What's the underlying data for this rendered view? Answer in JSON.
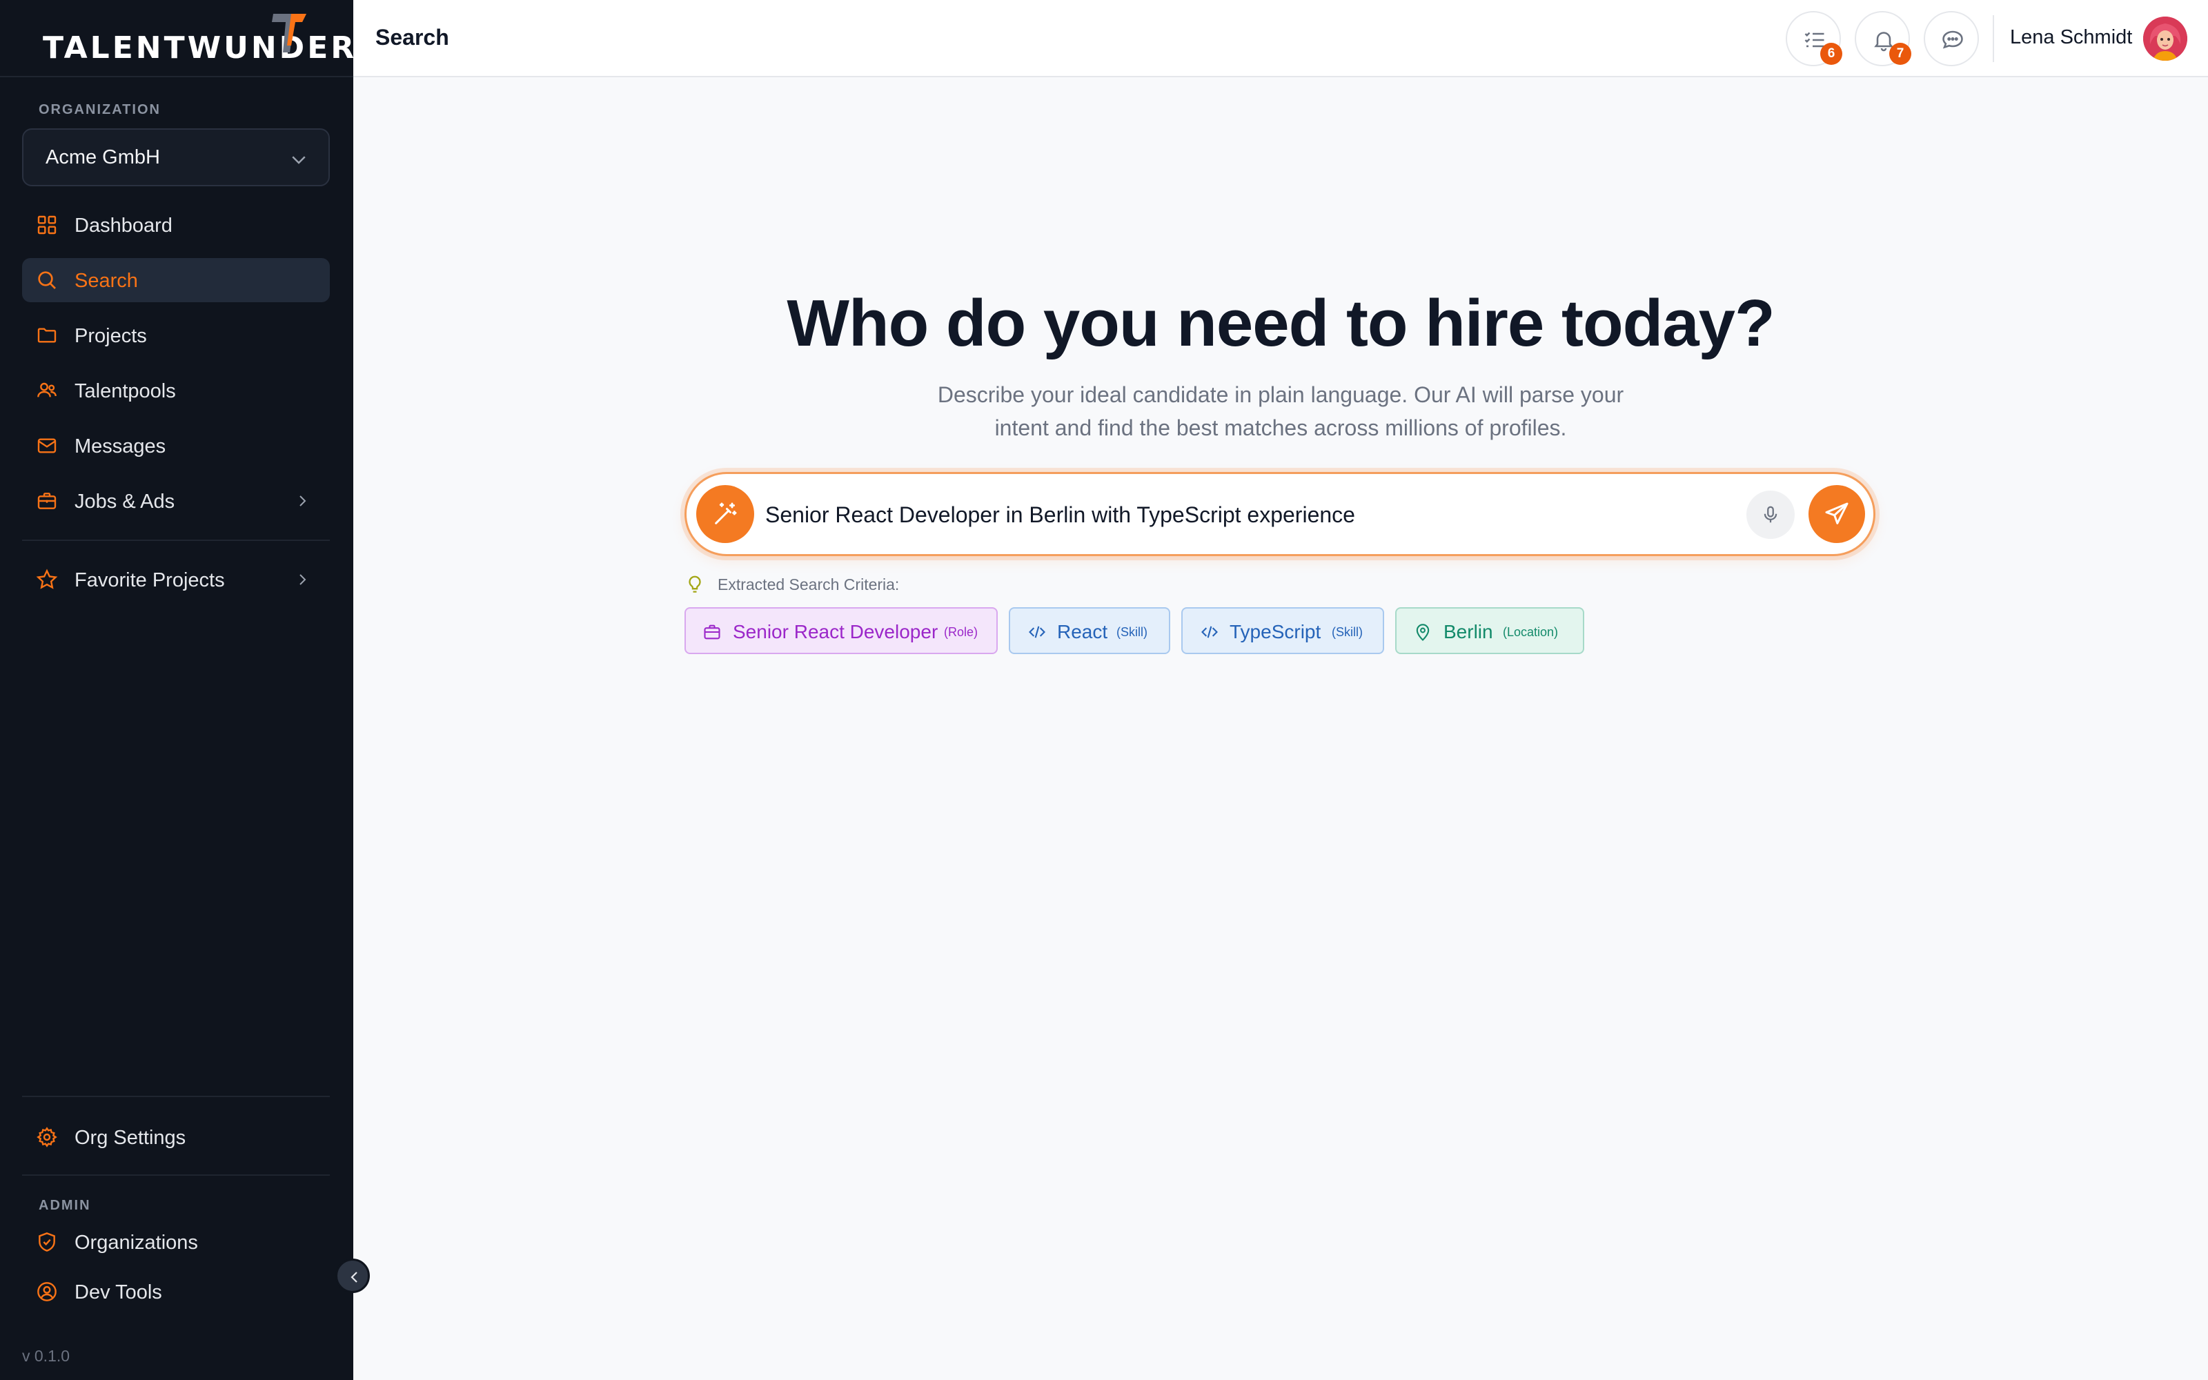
{
  "app": {
    "brand": "TALENTWUNDER",
    "version": "v 0.1.0"
  },
  "sidebar": {
    "org_label": "ORGANIZATION",
    "org_value": "Acme GmbH",
    "items": [
      {
        "label": "Dashboard",
        "icon": "grid-icon"
      },
      {
        "label": "Search",
        "icon": "search-icon",
        "active": true
      },
      {
        "label": "Projects",
        "icon": "folder-icon"
      },
      {
        "label": "Talentpools",
        "icon": "users-icon"
      },
      {
        "label": "Messages",
        "icon": "mail-icon"
      },
      {
        "label": "Jobs & Ads",
        "icon": "briefcase-icon",
        "expandable": true
      }
    ],
    "favorites": {
      "label": "Favorite Projects",
      "icon": "star-icon"
    },
    "settings": {
      "label": "Org Settings",
      "icon": "gear-icon"
    },
    "admin_label": "ADMIN",
    "admin_items": [
      {
        "label": "Organizations",
        "icon": "shield-icon"
      },
      {
        "label": "Dev Tools",
        "icon": "user-circle-icon"
      }
    ]
  },
  "header": {
    "title": "Search",
    "tasks_count": "6",
    "notifications_count": "7",
    "user_name": "Lena Schmidt"
  },
  "main": {
    "headline": "Who do you need to hire today?",
    "subtitle_line1": "Describe your ideal candidate in plain language. Our AI will parse your",
    "subtitle_line2": "intent and find the best matches across millions of profiles.",
    "search_value": "Senior React Developer in Berlin with TypeScript experience",
    "criteria_label": "Extracted Search Criteria:",
    "criteria": [
      {
        "label": "Senior React Developer",
        "type": "(Role)",
        "icon": "briefcase-icon"
      },
      {
        "label": "React",
        "type": "(Skill)",
        "icon": "code-icon"
      },
      {
        "label": "TypeScript",
        "type": "(Skill)",
        "icon": "code-icon"
      },
      {
        "label": "Berlin",
        "type": "(Location)",
        "icon": "map-pin-icon"
      }
    ]
  },
  "colors": {
    "accent": "#f97316",
    "sidebar_bg": "#0f141d",
    "role_chip": "#9b27c9",
    "skill_chip": "#2563b8",
    "location_chip": "#138a6a"
  }
}
